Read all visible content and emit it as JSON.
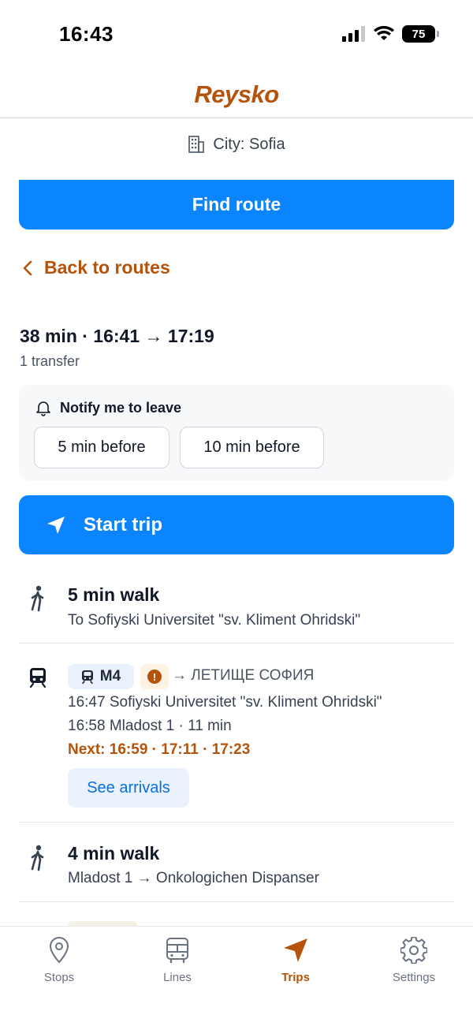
{
  "status_bar": {
    "time": "16:43",
    "battery": "75"
  },
  "header": {
    "logo": "Reysko"
  },
  "city": {
    "label": "City: Sofia"
  },
  "find_route": {
    "label": "Find route"
  },
  "back": {
    "label": "Back to routes"
  },
  "summary": {
    "title": "38 min · 16:41 → 17:19",
    "transfers": "1 transfer"
  },
  "notify": {
    "title": "Notify me to leave",
    "options": [
      "5 min before",
      "10 min before"
    ]
  },
  "start_trip": {
    "label": "Start trip"
  },
  "steps": [
    {
      "type": "walk",
      "icon": "walk-icon",
      "title": "5 min walk",
      "subtitle": "To Sofiyski Universitet \"sv. Kliment Ohridski\""
    },
    {
      "type": "metro",
      "icon": "metro-icon",
      "line": "M4",
      "direction": "→ ЛЕТИЩЕ СОФИЯ",
      "board": "16:47 Sofiyski Universitet \"sv. Kliment Ohridski\"",
      "alight": "16:58 Mladost 1 · 11 min",
      "next": "Next: 16:59 · 17:11 · 17:23",
      "arrivals_label": "See arrivals",
      "alert": "!"
    },
    {
      "type": "walk",
      "icon": "walk-icon",
      "title": "4 min walk",
      "subtitle": "Mladost 1 → Onkologichen Dispanser"
    }
  ],
  "tabs": [
    {
      "label": "Stops",
      "icon": "location-pin-icon",
      "active": false
    },
    {
      "label": "Lines",
      "icon": "bus-icon",
      "active": false
    },
    {
      "label": "Trips",
      "icon": "navigation-arrow-icon",
      "active": true
    },
    {
      "label": "Settings",
      "icon": "gear-icon",
      "active": false
    }
  ],
  "colors": {
    "accent": "#0a84ff",
    "brand": "#b45309",
    "text": "#111827",
    "muted": "#6b7280"
  }
}
